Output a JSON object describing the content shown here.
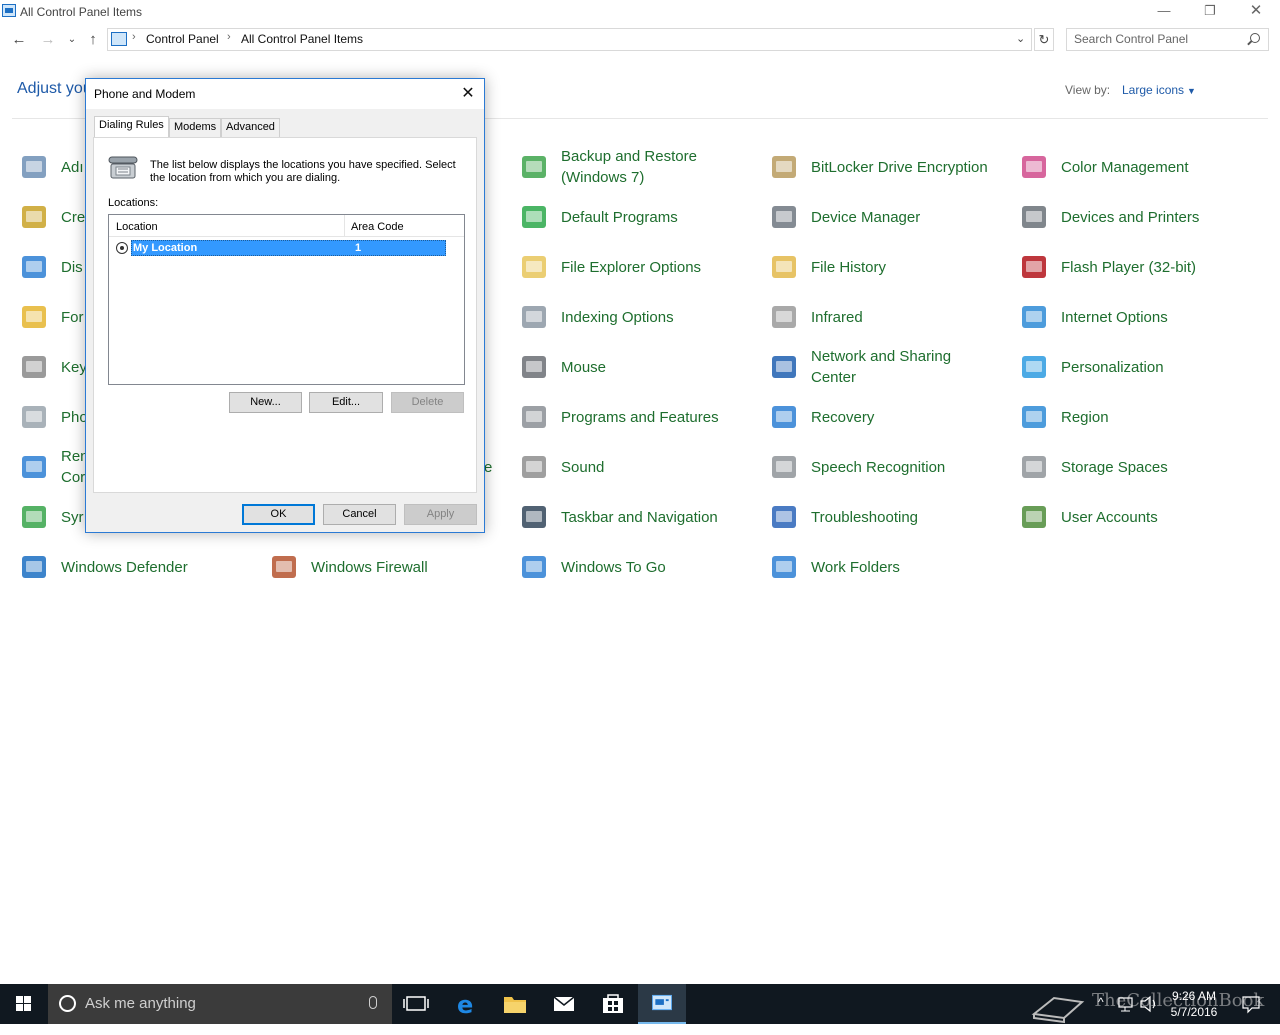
{
  "window": {
    "title": "All Control Panel Items",
    "minimize": "—",
    "restore": "❐",
    "close": "✕"
  },
  "address": {
    "crumbs": [
      "Control Panel",
      "All Control Panel Items"
    ],
    "search_placeholder": "Search Control Panel"
  },
  "header": {
    "adjust_text": "Adjust you",
    "view_by_label": "View by:",
    "view_by_value": "Large icons"
  },
  "items": [
    {
      "label": "Adı",
      "icon": "administrative-tools-icon",
      "color": "#6d8fb5"
    },
    {
      "label": "Cre",
      "icon": "credential-manager-icon",
      "color": "#c9a227"
    },
    {
      "label": "Dis",
      "icon": "display-icon",
      "color": "#2d7fd3"
    },
    {
      "label": "For",
      "icon": "fonts-icon",
      "color": "#e5b52f"
    },
    {
      "label": "Key",
      "icon": "keyboard-icon",
      "color": "#888888"
    },
    {
      "label": "Pho",
      "icon": "phone-modem-icon",
      "color": "#9aa4ad"
    },
    {
      "label": "Ren",
      "label2": "Cor",
      "icon": "remoteapp-icon",
      "color": "#2d7fd3"
    },
    {
      "label": "Syr",
      "icon": "sync-center-icon",
      "color": "#37a54a"
    },
    {
      "label": "Windows Defender",
      "icon": "windows-defender-icon",
      "color": "#1b6ec2"
    },
    {
      "label": "Windows Firewall",
      "icon": "windows-firewall-icon",
      "color": "#b5532f"
    },
    {
      "label": "Backup and Restore",
      "label2": "(Windows 7)",
      "icon": "backup-restore-icon",
      "color": "#3ea44c"
    },
    {
      "label": "Default Programs",
      "icon": "default-programs-icon",
      "color": "#2ba84a"
    },
    {
      "label": "File Explorer Options",
      "icon": "file-explorer-options-icon",
      "color": "#e8c55a"
    },
    {
      "label": "Indexing Options",
      "icon": "indexing-options-icon",
      "color": "#8c98a3"
    },
    {
      "label": "Mouse",
      "icon": "mouse-icon",
      "color": "#6b6f74"
    },
    {
      "label": "Programs and Features",
      "icon": "programs-features-icon",
      "color": "#8b8f95"
    },
    {
      "label": "Sound",
      "icon": "sound-icon",
      "color": "#8e8e8e"
    },
    {
      "label": "Taskbar and Navigation",
      "icon": "taskbar-navigation-icon",
      "color": "#33465a"
    },
    {
      "label": "Windows To Go",
      "icon": "windows-to-go-icon",
      "color": "#2d7fd3"
    },
    {
      "label": "BitLocker Drive Encryption",
      "icon": "bitlocker-icon",
      "color": "#b89b5e"
    },
    {
      "label": "Device Manager",
      "icon": "device-manager-icon",
      "color": "#6f7780"
    },
    {
      "label": "File History",
      "icon": "file-history-icon",
      "color": "#e3b94a"
    },
    {
      "label": "Infrared",
      "icon": "infrared-icon",
      "color": "#9a9a9a"
    },
    {
      "label": "Network and Sharing",
      "label2": "Center",
      "icon": "network-sharing-icon",
      "color": "#1f5fb0"
    },
    {
      "label": "Recovery",
      "icon": "recovery-icon",
      "color": "#2d7fd3"
    },
    {
      "label": "Speech Recognition",
      "icon": "speech-recognition-icon",
      "color": "#8f9499"
    },
    {
      "label": "Troubleshooting",
      "icon": "troubleshooting-icon",
      "color": "#2a64b8"
    },
    {
      "label": "Work Folders",
      "icon": "work-folders-icon",
      "color": "#2d7fd3"
    },
    {
      "label": "Color Management",
      "icon": "color-management-icon",
      "color": "#d04b8c"
    },
    {
      "label": "Devices and Printers",
      "icon": "devices-printers-icon",
      "color": "#6a7178"
    },
    {
      "label": "Flash Player (32-bit)",
      "icon": "flash-player-icon",
      "color": "#b3141b"
    },
    {
      "label": "Internet Options",
      "icon": "internet-options-icon",
      "color": "#2e8bd6"
    },
    {
      "label": "Personalization",
      "icon": "personalization-icon",
      "color": "#2d9be0"
    },
    {
      "label": "Region",
      "icon": "region-icon",
      "color": "#2e8bd6"
    },
    {
      "label": "Storage Spaces",
      "icon": "storage-spaces-icon",
      "color": "#8f9499"
    },
    {
      "label": "User Accounts",
      "icon": "user-accounts-icon",
      "color": "#4e8c3a"
    },
    {
      "label": "e",
      "icon": "hidden-item-fragment",
      "color": "#1e6e2e"
    }
  ],
  "dialog": {
    "title": "Phone and Modem",
    "tabs": [
      "Dialing Rules",
      "Modems",
      "Advanced"
    ],
    "description": "The list below displays the locations you have specified. Select the location from which you are dialing.",
    "locations_label": "Locations:",
    "columns": [
      "Location",
      "Area Code"
    ],
    "rows": [
      {
        "location": "My Location",
        "area_code": "1"
      }
    ],
    "buttons": {
      "new": "New...",
      "edit": "Edit...",
      "delete": "Delete",
      "ok": "OK",
      "cancel": "Cancel",
      "apply": "Apply"
    }
  },
  "taskbar": {
    "search_text": "Ask me anything",
    "time": "9:26 AM",
    "date": "5/7/2016",
    "watermark": "TheCollectionBook"
  },
  "colors": {
    "link_green": "#1e6e2e",
    "link_blue": "#1e5aa8",
    "accent": "#0078d7",
    "taskbar": "#101820"
  }
}
